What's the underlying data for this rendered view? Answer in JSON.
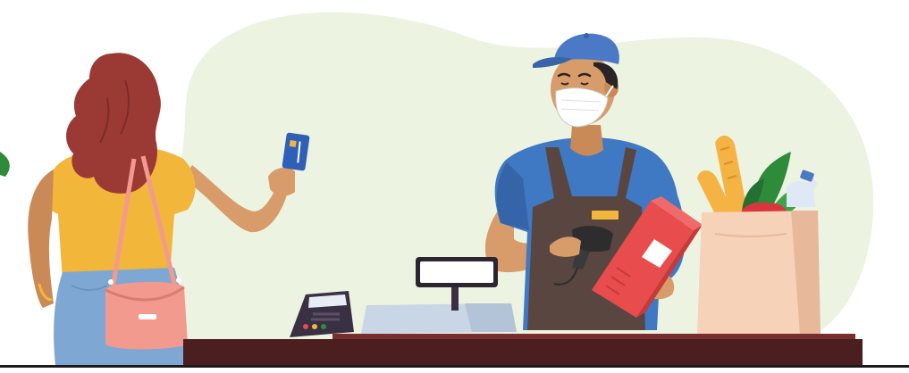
{
  "scene": {
    "subject": "checkout-illustration",
    "palette": {
      "background_blob": "#edf3e1",
      "counter": "#4b1f1f",
      "counter_top": "#7a2d2d",
      "floor_line": "#1b1b1b",
      "customer_hair": "#9b3a35",
      "customer_top": "#f2b63b",
      "customer_skin": "#d79c6a",
      "jeans": "#7ea8d3",
      "handbag": "#f29a8d",
      "cashier_cap": "#4b79c6",
      "cashier_shirt": "#3f78c3",
      "apron": "#5a4640",
      "mask": "#ffffff",
      "scanner": "#2d2d2d",
      "product_box": "#e84c4c",
      "pos_terminal": "#3a3044",
      "card": "#2f5fb7",
      "grocery_bag": "#f5d2b8",
      "baguette": "#f5b344",
      "greens": "#2e8b3a",
      "bottle": "#dfe8f5"
    },
    "icons": [
      "customer-figure-icon",
      "cashier-figure-icon",
      "credit-card-icon",
      "card-terminal-icon",
      "barcode-scanner-icon",
      "product-box-icon",
      "grocery-bag-icon",
      "cash-register-icon",
      "checkout-counter-icon"
    ]
  }
}
